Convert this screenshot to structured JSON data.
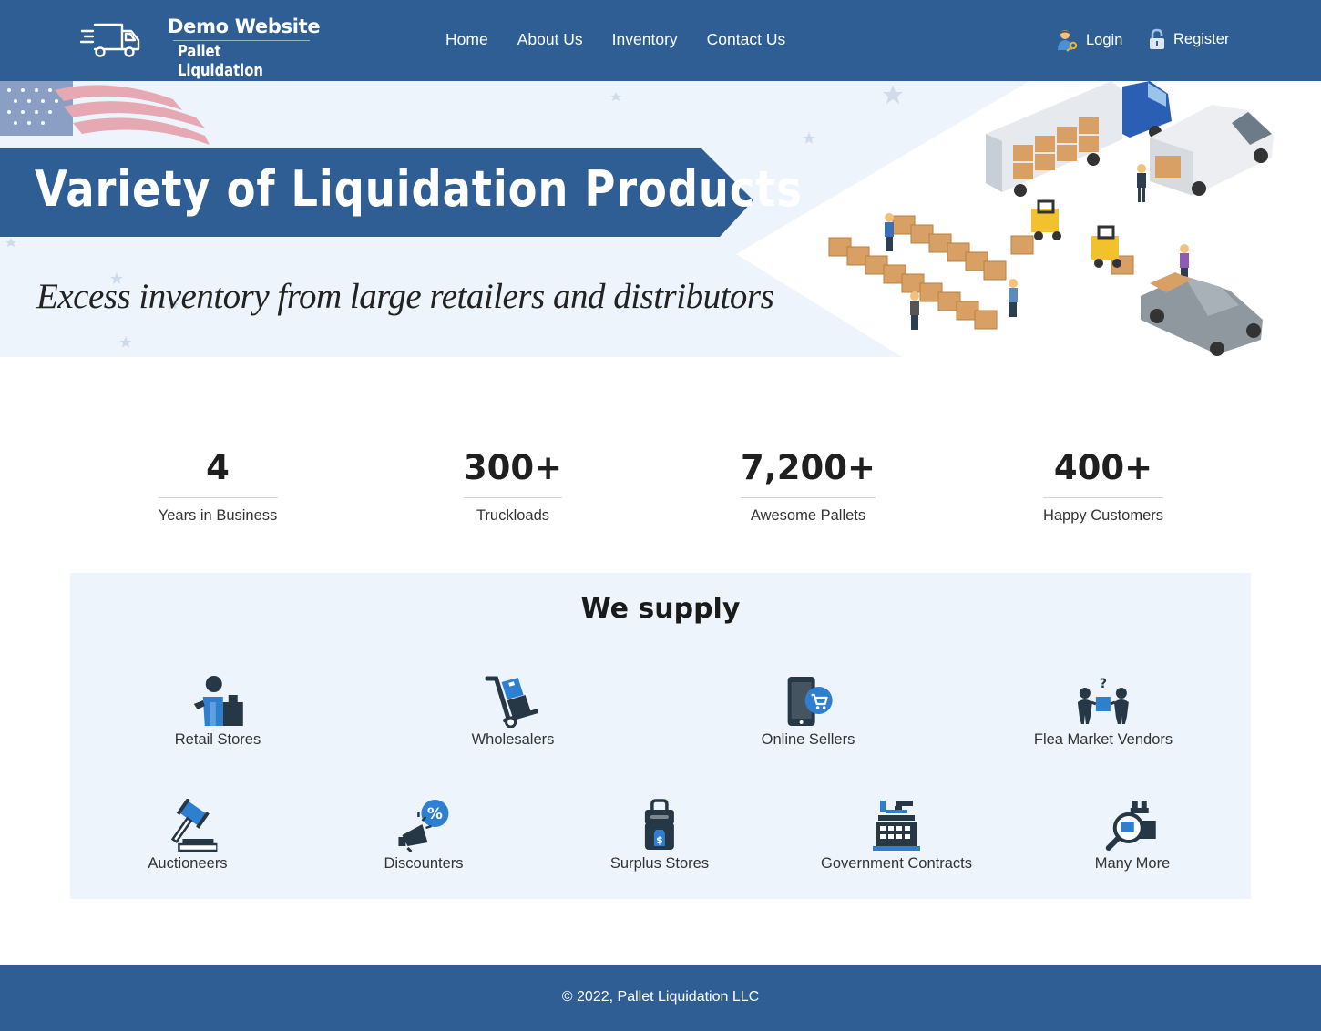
{
  "brand": {
    "title": "Demo Website",
    "subtitle": "Pallet Liquidation",
    "icon": "truck-icon"
  },
  "nav": {
    "items": [
      "Home",
      "About Us",
      "Inventory",
      "Contact Us"
    ]
  },
  "auth": {
    "login": "Login",
    "register": "Register",
    "login_icon": "user-key-icon",
    "register_icon": "padlock-icon"
  },
  "hero": {
    "title": "Variety of Liquidation Products",
    "subtitle": "Excess inventory from large retailers and distributors"
  },
  "stats": [
    {
      "value": "4",
      "label": "Years in Business"
    },
    {
      "value": "300+",
      "label": "Truckloads"
    },
    {
      "value": "7,200+",
      "label": "Awesome Pallets"
    },
    {
      "value": "400+",
      "label": "Happy Customers"
    }
  ],
  "supply": {
    "title": "We supply",
    "row1": [
      {
        "label": "Retail Stores",
        "icon": "cashier-icon"
      },
      {
        "label": "Wholesalers",
        "icon": "hand-truck-icon"
      },
      {
        "label": "Online Sellers",
        "icon": "mobile-cart-icon"
      },
      {
        "label": "Flea Market Vendors",
        "icon": "people-exchange-icon"
      }
    ],
    "row2": [
      {
        "label": "Auctioneers",
        "icon": "gavel-icon"
      },
      {
        "label": "Discounters",
        "icon": "megaphone-percent-icon"
      },
      {
        "label": "Surplus Stores",
        "icon": "shopping-bag-icon"
      },
      {
        "label": "Government Contracts",
        "icon": "government-building-icon"
      },
      {
        "label": "Many More",
        "icon": "magnifier-box-icon"
      }
    ]
  },
  "footer": {
    "text": "© 2022, Pallet Liquidation LLC"
  },
  "colors": {
    "primary": "#2e5e93",
    "panel": "#eef4fb",
    "accent_blue": "#2f7fd0",
    "icon_dark": "#263746"
  }
}
